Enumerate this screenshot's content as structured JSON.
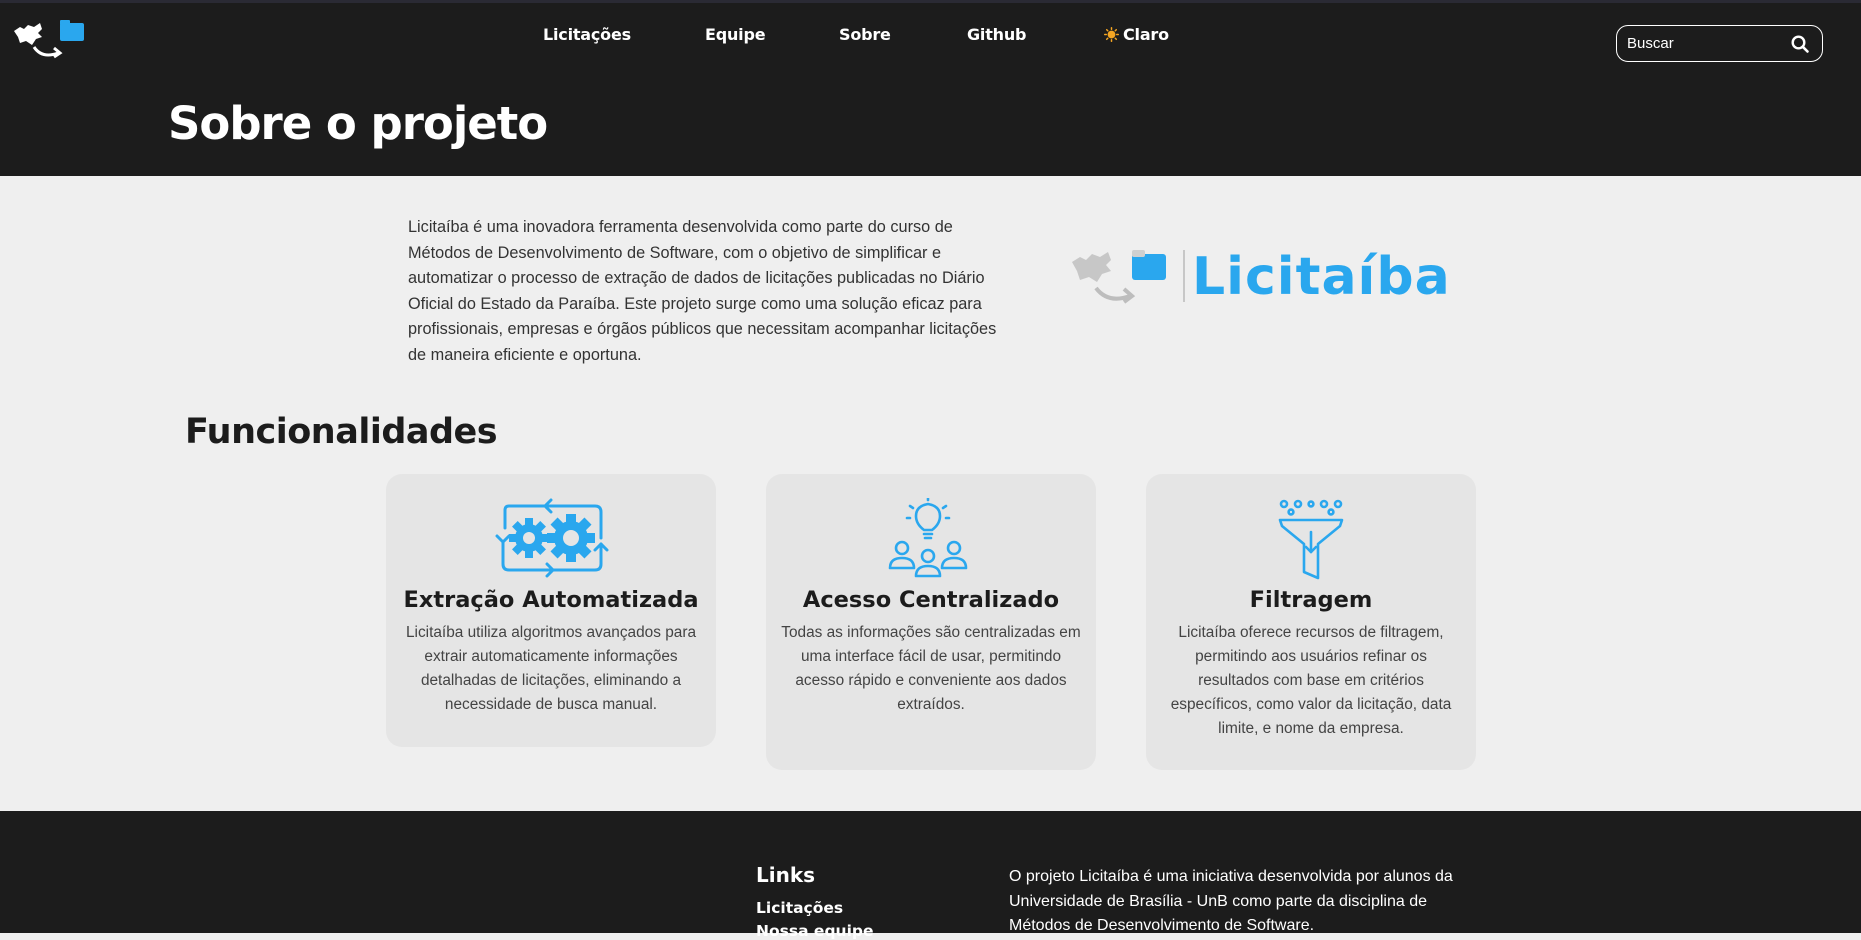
{
  "nav": {
    "items": [
      {
        "label": "Licitações"
      },
      {
        "label": "Equipe"
      },
      {
        "label": "Sobre"
      },
      {
        "label": "Github"
      }
    ],
    "theme_toggle_label": "Claro",
    "theme_icon": "sun-icon"
  },
  "search": {
    "placeholder": "Buscar",
    "value": "",
    "icon": "search-icon"
  },
  "hero": {
    "title": "Sobre o projeto"
  },
  "about": {
    "text": "Licitaíba é uma inovadora ferramenta desenvolvida como parte do curso de Métodos de Desenvolvimento de Software, com o objetivo de simplificar e automatizar o processo de extração de dados de licitações publicadas no Diário Oficial do Estado da Paraíba. Este projeto surge como uma solução eficaz para profissionais, empresas e órgãos públicos que necessitam acompanhar licitações de maneira eficiente e oportuna.",
    "brand_name": "Licitaíba"
  },
  "features": {
    "title": "Funcionalidades",
    "cards": [
      {
        "icon": "gears-automation-icon",
        "title": "Extração Automatizada",
        "description": "Licitaíba utiliza algoritmos avançados para extrair automaticamente informações detalhadas de licitações, eliminando a necessidade de busca manual."
      },
      {
        "icon": "team-idea-icon",
        "title": "Acesso Centralizado",
        "description": "Todas as informações são centralizadas em uma interface fácil de usar, permitindo acesso rápido e conveniente aos dados extraídos."
      },
      {
        "icon": "funnel-filter-icon",
        "title": "Filtragem",
        "description": "Licitaíba oferece recursos de filtragem, permitindo aos usuários refinar os resultados com base em critérios específicos, como valor da licitação, data limite, e nome da empresa."
      }
    ]
  },
  "footer": {
    "links_title": "Links",
    "links": [
      {
        "label": "Licitações"
      },
      {
        "label": "Nossa equipe"
      }
    ],
    "about_text": "O projeto Licitaíba é uma iniciativa desenvolvida por alunos da Universidade de Brasília - UnB como parte da disciplina de Métodos de Desenvolvimento de Software."
  },
  "colors": {
    "brand_blue": "#2aa7ee",
    "dark_bg": "#1c1c1c",
    "light_bg": "#efefef",
    "card_bg": "#e5e5e5"
  }
}
